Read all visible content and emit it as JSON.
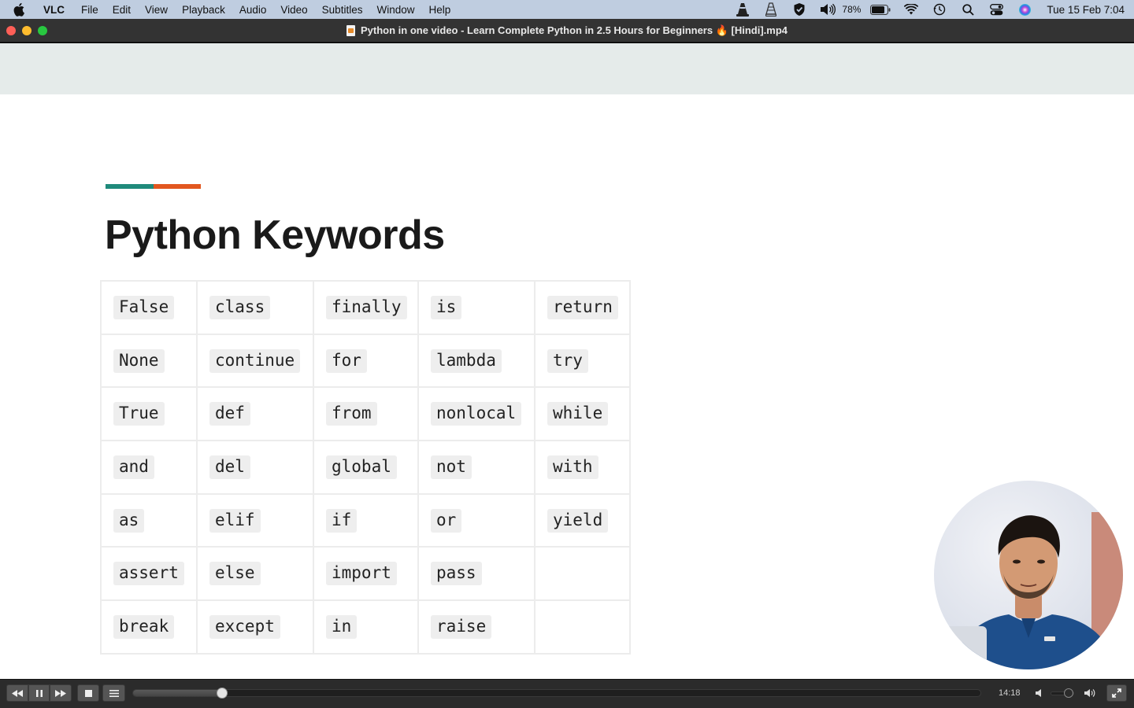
{
  "menubar": {
    "app_name": "VLC",
    "items": [
      "File",
      "Edit",
      "View",
      "Playback",
      "Audio",
      "Video",
      "Subtitles",
      "Window",
      "Help"
    ],
    "battery_percent": "78%",
    "clock": "Tue 15 Feb  7:04",
    "status_icons": [
      "vlc-cone-icon",
      "vlc-cone-outline-icon",
      "shield-icon",
      "volume-icon",
      "battery-icon",
      "wifi-icon",
      "time-machine-icon",
      "spotlight-search-icon",
      "control-center-icon",
      "siri-icon"
    ]
  },
  "window": {
    "title": "Python in one video - Learn Complete Python in 2.5 Hours for Beginners 🔥  [Hindi].mp4"
  },
  "slide": {
    "title": "Python Keywords",
    "accent_colors": [
      "#1f8a7b",
      "#e2571f"
    ],
    "keywords": [
      [
        "False",
        "class",
        "finally",
        "is",
        "return"
      ],
      [
        "None",
        "continue",
        "for",
        "lambda",
        "try"
      ],
      [
        "True",
        "def",
        "from",
        "nonlocal",
        "while"
      ],
      [
        "and",
        "del",
        "global",
        "not",
        "with"
      ],
      [
        "as",
        "elif",
        "if",
        "or",
        "yield"
      ],
      [
        "assert",
        "else",
        "import",
        "pass",
        ""
      ],
      [
        "break",
        "except",
        "in",
        "raise",
        ""
      ]
    ]
  },
  "controls": {
    "buttons": [
      "rewind-icon",
      "pause-icon",
      "fast-forward-icon",
      "stop-icon",
      "playlist-icon"
    ],
    "playback_progress": 0.105,
    "time_display": "14:18",
    "volume_level": 0.6
  }
}
